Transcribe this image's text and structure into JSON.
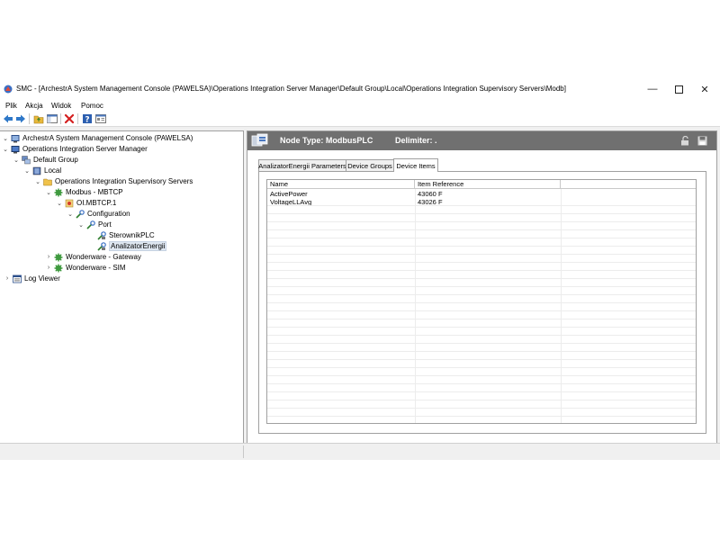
{
  "window": {
    "title": "SMC - [ArchestrA System Management Console (PAWELSA)\\Operations Integration Server Manager\\Default Group\\Local\\Operations Integration Supervisory Servers\\Modb]",
    "controls": [
      "minimize-icon",
      "maximize-icon",
      "close-icon"
    ]
  },
  "menu": {
    "items": [
      "Plik",
      "Akcja",
      "Widok",
      "Pomoc"
    ]
  },
  "toolbar": {
    "buttons": [
      "back-icon",
      "forward-icon",
      "up-folder-icon",
      "show-hide-tree-icon",
      "delete-icon",
      "help-icon",
      "properties-icon"
    ]
  },
  "tree": {
    "nodes": [
      {
        "label": "ArchestrA System Management Console (PAWELSA)",
        "icon": "console-icon",
        "expanded": true
      },
      {
        "label": "Operations Integration Server Manager",
        "icon": "server-manager-icon",
        "expanded": true
      },
      {
        "label": "Default Group",
        "icon": "group-icon",
        "expanded": true
      },
      {
        "label": "Local",
        "icon": "computer-icon",
        "expanded": true
      },
      {
        "label": "Operations Integration Supervisory Servers",
        "icon": "folder-icon",
        "expanded": true
      },
      {
        "label": "Modbus - MBTCP",
        "icon": "gear-icon",
        "expanded": true
      },
      {
        "label": "OI.MBTCP.1",
        "icon": "server-object-icon",
        "expanded": true
      },
      {
        "label": "Configuration",
        "icon": "configuration-icon",
        "expanded": true
      },
      {
        "label": "Port",
        "icon": "port-icon",
        "expanded": true
      },
      {
        "label": "SterownikPLC",
        "icon": "plc-icon"
      },
      {
        "label": "AnalizatorEnergii",
        "icon": "plc-icon",
        "selected": true
      },
      {
        "label": "Wonderware - Gateway",
        "icon": "gear-icon",
        "expanded": false
      },
      {
        "label": "Wonderware - SIM",
        "icon": "gear-icon",
        "expanded": false
      },
      {
        "label": "Log Viewer",
        "icon": "log-viewer-icon",
        "expanded": false
      }
    ]
  },
  "header": {
    "node_type": "Node Type: ModbusPLC",
    "delimiter": "Delimiter:  ."
  },
  "tabs": [
    {
      "label": "AnalizatorEnergii Parameters",
      "active": false
    },
    {
      "label": "Device Groups",
      "active": false
    },
    {
      "label": "Device Items",
      "active": true
    }
  ],
  "device_items": {
    "columns": [
      "Name",
      "Item Reference"
    ],
    "rows": [
      {
        "name": "ActivePower",
        "reference": "43060 F"
      },
      {
        "name": "VoltageLLAvg",
        "reference": "43026 F"
      }
    ]
  },
  "colors": {
    "header_band": "#707070",
    "selection": "#dfe7f1",
    "close_red": "#d42020"
  }
}
